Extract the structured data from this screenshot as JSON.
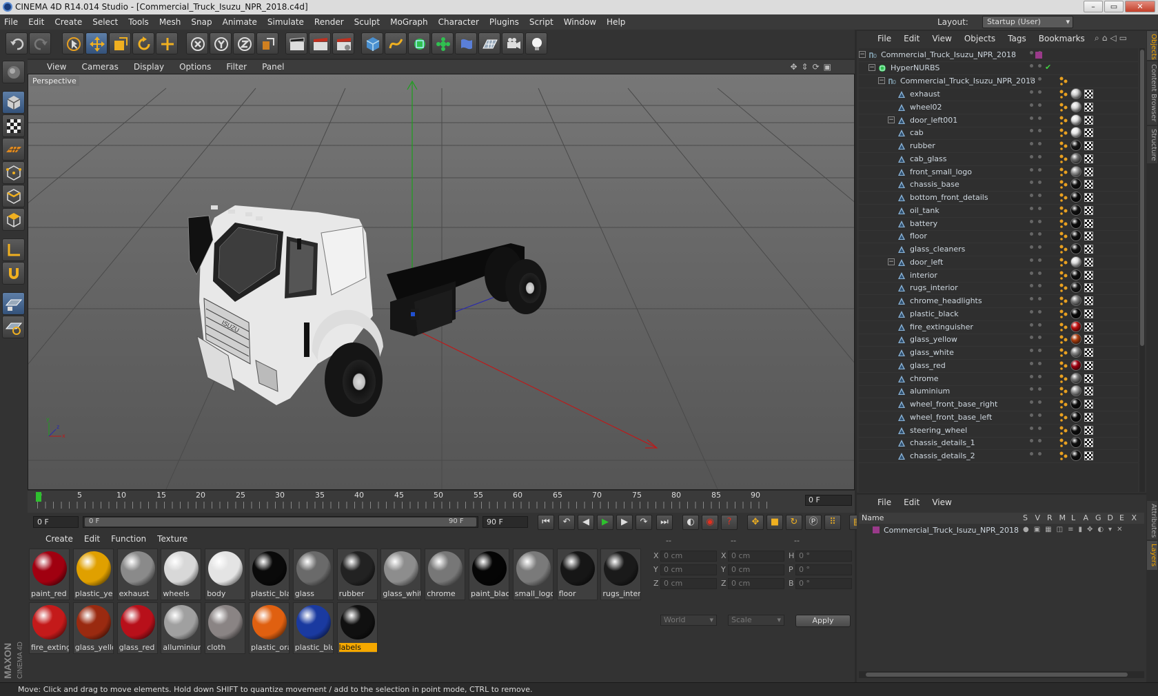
{
  "window": {
    "title": "CINEMA 4D R14.014 Studio - [Commercial_Truck_Isuzu_NPR_2018.c4d]",
    "btn_min": "–",
    "btn_max": "▭",
    "btn_close": "✕"
  },
  "menu": [
    "File",
    "Edit",
    "Create",
    "Select",
    "Tools",
    "Mesh",
    "Snap",
    "Animate",
    "Simulate",
    "Render",
    "Sculpt",
    "MoGraph",
    "Character",
    "Plugins",
    "Script",
    "Window",
    "Help"
  ],
  "layout": {
    "label": "Layout:",
    "value": "Startup (User)"
  },
  "viewport": {
    "menu": [
      "View",
      "Cameras",
      "Display",
      "Options",
      "Filter",
      "Panel"
    ],
    "label": "Perspective",
    "truck_logo": "ISUZU"
  },
  "timeline": {
    "ticks": [
      "0",
      "5",
      "10",
      "15",
      "20",
      "25",
      "30",
      "35",
      "40",
      "45",
      "50",
      "55",
      "60",
      "65",
      "70",
      "75",
      "80",
      "85",
      "90"
    ],
    "current": "0 F"
  },
  "transport": {
    "start": "0 F",
    "range_start": "0 F",
    "range_end": "90 F",
    "end": "90 F"
  },
  "materials": {
    "menu": [
      "Create",
      "Edit",
      "Function",
      "Texture"
    ],
    "items": [
      {
        "name": "paint_red",
        "color": "#a00010"
      },
      {
        "name": "plastic_yell",
        "color": "#e0a000"
      },
      {
        "name": "exhaust",
        "color": "#8a8a8a"
      },
      {
        "name": "wheels",
        "color": "#d8d8d8"
      },
      {
        "name": "body",
        "color": "#e4e4e4"
      },
      {
        "name": "plastic_blac",
        "color": "#0a0a0a"
      },
      {
        "name": "glass",
        "color": "#6a6a6a"
      },
      {
        "name": "rubber",
        "color": "#222222"
      },
      {
        "name": "glass_white",
        "color": "#8d8d8d"
      },
      {
        "name": "chrome",
        "color": "#777777"
      },
      {
        "name": "paint_black",
        "color": "#050505"
      },
      {
        "name": "small_logo",
        "color": "#7a7a7a"
      },
      {
        "name": "floor",
        "color": "#161616"
      },
      {
        "name": "rugs_interi",
        "color": "#1a1a1a"
      },
      {
        "name": "fire_exting",
        "color": "#c41a1a"
      },
      {
        "name": "glass_yello",
        "color": "#9a2a10"
      },
      {
        "name": "glass_red",
        "color": "#b8101a"
      },
      {
        "name": "alluminium",
        "color": "#a0a0a0"
      },
      {
        "name": "cloth",
        "color": "#8a8484"
      },
      {
        "name": "plastic_ora",
        "color": "#e06010"
      },
      {
        "name": "plastic_blu",
        "color": "#1a3aa0"
      },
      {
        "name": "labels",
        "color": "#101010"
      }
    ]
  },
  "attributes": {
    "x": "X",
    "y": "Y",
    "z": "Z",
    "h": "H",
    "p": "P",
    "b": "B",
    "pos_x": "0 cm",
    "pos_y": "0 cm",
    "pos_z": "0 cm",
    "size_x": "0 cm",
    "size_y": "0 cm",
    "size_z": "0 cm",
    "rot_h": "0 °",
    "rot_p": "0 °",
    "rot_b": "0 °",
    "coord": "World",
    "mode": "Scale",
    "apply": "Apply",
    "h1": "--",
    "h2": "--",
    "h3": "--"
  },
  "objects": {
    "menu": [
      "File",
      "Edit",
      "View",
      "Objects",
      "Tags",
      "Bookmarks"
    ],
    "root": "Commercial_Truck_Isuzu_NPR_2018",
    "hypernurbs": "HyperNURBS",
    "group": "Commercial_Truck_Isuzu_NPR_2018",
    "children": [
      "exhaust",
      "wheel02",
      "door_left001",
      "cab",
      "rubber",
      "cab_glass",
      "front_small_logo",
      "chassis_base",
      "bottom_front_details",
      "oil_tank",
      "battery",
      "floor",
      "glass_cleaners",
      "door_left",
      "interior",
      "rugs_interior",
      "chrome_headlights",
      "plastic_black",
      "fire_extinguisher",
      "glass_yellow",
      "glass_white",
      "glass_red",
      "chrome",
      "aluminium",
      "wheel_front_base_right",
      "wheel_front_base_left",
      "steering_wheel",
      "chassis_details_1",
      "chassis_details_2"
    ],
    "tagcolors": [
      "#cfcfcf",
      "#d8d8d8",
      "#e0e0e0",
      "#e6e6e6",
      "#1a1a1a",
      "#707070",
      "#9a9a9a",
      "#111111",
      "#0d0d0d",
      "#111111",
      "#0c0c0c",
      "#121212",
      "#141414",
      "#dcdcdc",
      "#101010",
      "#1a1a1a",
      "#808080",
      "#0a0a0a",
      "#c01010",
      "#b04010",
      "#888888",
      "#a00010",
      "#7a7a7a",
      "#9a9a9a",
      "#0d0d0d",
      "#0d0d0d",
      "#0d0d0d",
      "#101010",
      "#101010"
    ]
  },
  "sidetabs": [
    "Objects",
    "Content Browser",
    "Structure",
    "Attributes",
    "Layers"
  ],
  "layers": {
    "menu": [
      "File",
      "Edit",
      "View"
    ],
    "headers": {
      "name": "Name",
      "cols": [
        "S",
        "V",
        "R",
        "M",
        "L",
        "A",
        "G",
        "D",
        "E",
        "X"
      ]
    },
    "row": "Commercial_Truck_Isuzu_NPR_2018"
  },
  "brand": {
    "maxon": "MAXON",
    "c4d": "CINEMA 4D"
  },
  "status": "Move: Click and drag to move elements. Hold down SHIFT to quantize movement / add to the selection in point mode, CTRL to remove."
}
